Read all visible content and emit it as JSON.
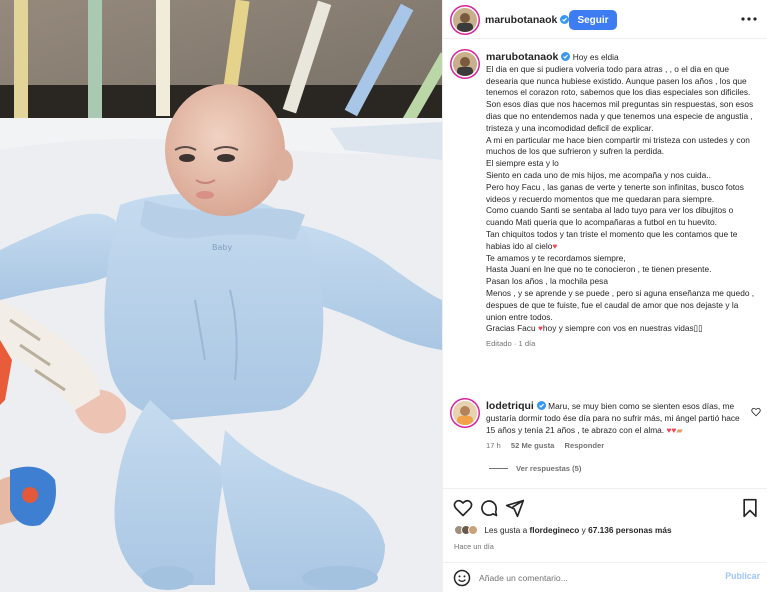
{
  "post_image": {
    "alt": "baby-in-light-blue-onesie-in-crib",
    "print": "Baby"
  },
  "header": {
    "username": "marubotanaok",
    "follow_label": "Seguir",
    "more_icon": "more-horizontal-icon"
  },
  "caption": {
    "username": "marubotanaok",
    "first_line": "Hoy es eldia",
    "paragraphs": [
      "El dia en que si pudiera volveria todo para atras , , o el dia en que desearia que nunca hubiese existido. Aunque pasen los años , los que tenemos el corazon roto, sabemos que los dias especiales son dificiles.",
      "Son esos dias que nos hacemos mil preguntas sin respuestas, son esos dias que no entendemos nada y que tenemos una especie de angustia , tristeza y una incomodidad deficil de explicar.",
      "A mi en particular me hace bien compartir mi tristeza con ustedes y con muchos de los que sufrieron y sufren la perdida.",
      "El siempre esta y lo",
      "Siento en cada uno de mis hijos, me acompaña y nos cuida..",
      "Pero hoy Facu , las ganas de verte y tenerte son infinitas, busco fotos videos y recuerdo momentos que me quedaran para siempre.",
      "Como cuando Santi se sentaba al lado tuyo para ver los dibujitos o cuando Mati queria que lo acompañaras a futbol en tu huevito.",
      "Tan chiquitos todos y tan triste el momento que les contamos que te habias ido al cielo",
      "Te amamos y te recordamos siempre,",
      "Hasta Juani en lne que no te conocieron , te tienen presente.",
      "Pasan los años , la mochila pesa",
      "Menos , y se aprende y se puede , pero si aguna enseñanza me quedo , despues de que te fuiste, fue el caudal de amor que nos dejaste y la union entre todos.",
      "Gracias Facu",
      "hoy y siempre con vos en nuestras vidas"
    ],
    "edited": "Editado · 1 día"
  },
  "comment": {
    "username": "lodetriqui",
    "text": "Maru, se muy bien como se sienten esos días, me gustaría dormir todo ése día para no sufrir más, mi ángel partió hace 15 años y tenía 21 años , te abrazo con el alma.",
    "time": "17 h",
    "likes": "52 Me gusta",
    "reply": "Responder",
    "view_replies": "Ver respuestas (5)"
  },
  "actions": {
    "liked_by_prefix": "Les gusta a",
    "liked_by_user": "flordegineco",
    "liked_by_and": "y",
    "liked_by_count": "67.136 personas más",
    "time_ago": "Hace un día"
  },
  "add_comment": {
    "placeholder": "Añade un comentario...",
    "publish_label": "Publicar"
  },
  "colors": {
    "accent": "#3d7cf3",
    "heart": "#ed4956",
    "muted": "#737373"
  }
}
